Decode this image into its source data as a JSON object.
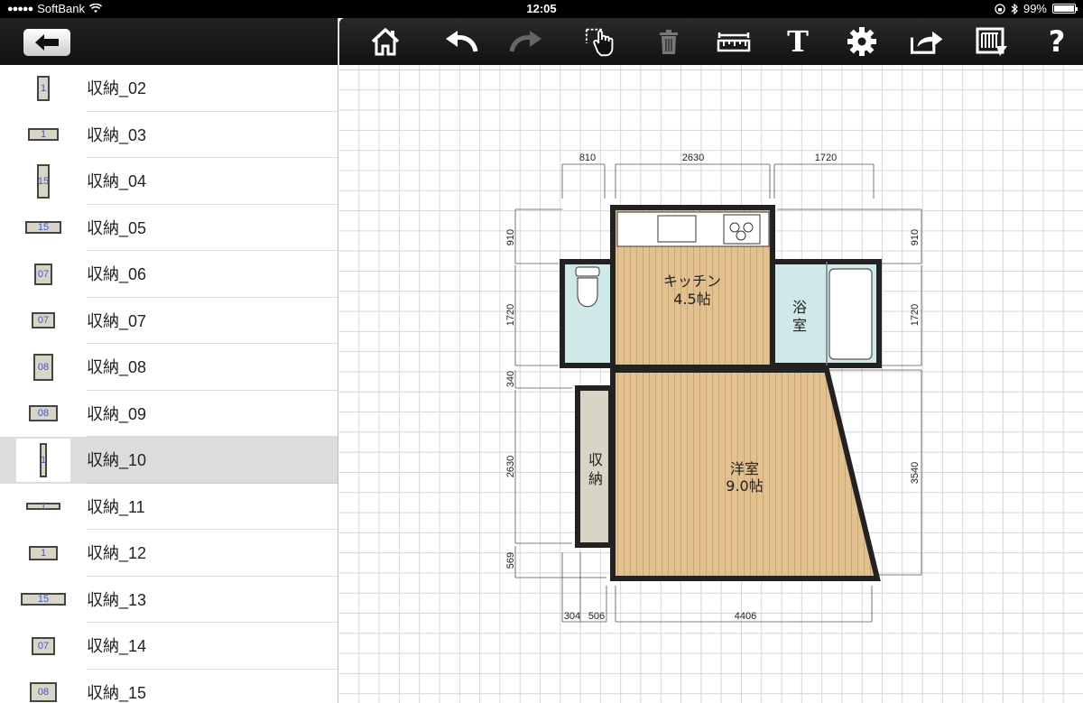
{
  "status": {
    "carrier": "SoftBank",
    "time": "12:05",
    "battery": "99%",
    "battery_fill": 0.99
  },
  "sidebar": {
    "back_icon": "arrow-left-icon",
    "items": [
      {
        "label": "収納_02",
        "thumb": "1"
      },
      {
        "label": "収納_03",
        "thumb": "1"
      },
      {
        "label": "収納_04",
        "thumb": "15"
      },
      {
        "label": "収納_05",
        "thumb": "15"
      },
      {
        "label": "収納_06",
        "thumb": "07"
      },
      {
        "label": "収納_07",
        "thumb": "07"
      },
      {
        "label": "収納_08",
        "thumb": "08"
      },
      {
        "label": "収納_09",
        "thumb": "08"
      },
      {
        "label": "収納_10",
        "thumb": "1",
        "selected": true
      },
      {
        "label": "収納_11",
        "thumb": "1"
      },
      {
        "label": "収納_12",
        "thumb": "1"
      },
      {
        "label": "収納_13",
        "thumb": "15"
      },
      {
        "label": "収納_14",
        "thumb": "07"
      },
      {
        "label": "収納_15",
        "thumb": "08"
      }
    ]
  },
  "toolbar": {
    "tools": [
      "home-icon",
      "undo-icon",
      "redo-icon",
      "select-hand-icon",
      "trash-icon",
      "ruler-icon",
      "text-icon",
      "gear-icon",
      "share-icon",
      "print-icon",
      "help-icon"
    ],
    "text_tool_label": "T",
    "help_label": "?"
  },
  "plan": {
    "rooms": {
      "kitchen_name": "キッチン",
      "kitchen_size": "4.5帖",
      "bath_line1": "浴",
      "bath_line2": "室",
      "storage_line1": "収",
      "storage_line2": "納",
      "western_name": "洋室",
      "western_size": "9.0帖"
    },
    "dims": {
      "top1": "810",
      "top2": "2630",
      "top3": "1720",
      "left1": "910",
      "left2": "1720",
      "left3": "340",
      "left4": "2630",
      "left5": "569",
      "right1": "910",
      "right2": "1720",
      "right3": "3540",
      "bottom1": "304",
      "bottom2": "506",
      "bottom3": "4406"
    },
    "colors": {
      "wood": "#e2c08f",
      "tile": "#cfe8e8",
      "storage": "#d9d5c6",
      "wall": "#222222"
    }
  }
}
